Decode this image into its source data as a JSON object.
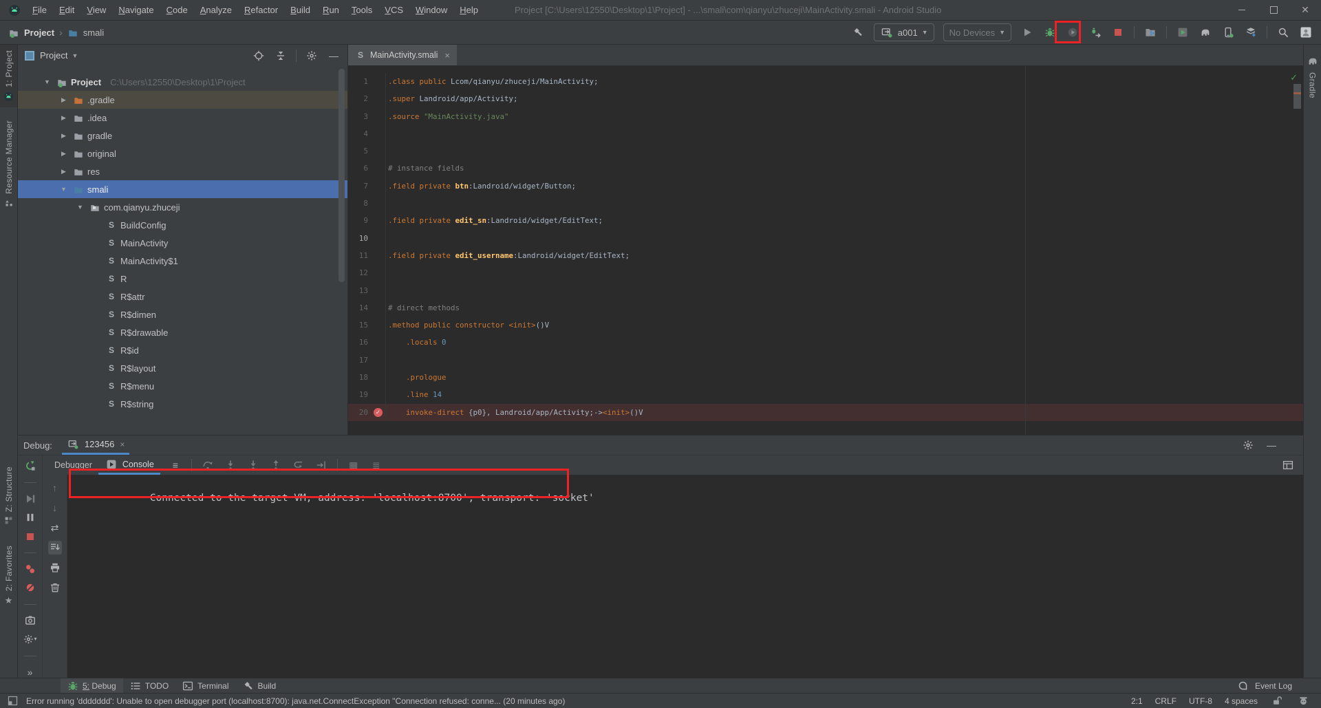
{
  "window": {
    "title": "Project [C:\\Users\\12550\\Desktop\\1\\Project] - ...\\smali\\com\\qianyu\\zhuceji\\MainActivity.smali - Android Studio",
    "menus": [
      "File",
      "Edit",
      "View",
      "Navigate",
      "Code",
      "Analyze",
      "Refactor",
      "Build",
      "Run",
      "Tools",
      "VCS",
      "Window",
      "Help"
    ],
    "controls": [
      "minimize",
      "maximize",
      "close"
    ]
  },
  "toolbar": {
    "breadcrumb_root": "Project",
    "breadcrumb_current": "smali",
    "run_config": "a001",
    "device_selector": "No Devices",
    "left_icons": [
      "build-hammer"
    ],
    "right_icons": [
      "run",
      "debug-bug",
      "profile",
      "attach-debugger",
      "stop",
      "|",
      "profile-apk",
      "|",
      "run-emulator",
      "gradle-sync",
      "avd-manager",
      "sdk-manager",
      "|",
      "search-everywhere",
      "user-avatar"
    ]
  },
  "left_stripe": {
    "project_tab": "1: Project",
    "resource_manager_tab": "Resource Manager",
    "structure_tab": "Z: Structure",
    "favorites_tab": "2: Favorites"
  },
  "project_panel": {
    "header": "Project",
    "header_icons": [
      "locate-file",
      "expand-collapse",
      "|",
      "panel-settings-gear",
      "hide-panel"
    ],
    "tree": [
      {
        "lvl": 0,
        "exp": true,
        "icon": "project-folder",
        "label": "Project",
        "path": "C:\\Users\\12550\\Desktop\\1\\Project",
        "bold": true
      },
      {
        "lvl": 1,
        "exp": false,
        "icon": "folder-gradle",
        "label": ".gradle",
        "hover": true
      },
      {
        "lvl": 1,
        "exp": false,
        "icon": "folder",
        "label": ".idea"
      },
      {
        "lvl": 1,
        "exp": false,
        "icon": "folder",
        "label": "gradle"
      },
      {
        "lvl": 1,
        "exp": false,
        "icon": "folder",
        "label": "original"
      },
      {
        "lvl": 1,
        "exp": false,
        "icon": "folder",
        "label": "res"
      },
      {
        "lvl": 1,
        "exp": true,
        "icon": "folder-blue",
        "label": "smali",
        "selected": true
      },
      {
        "lvl": 2,
        "exp": true,
        "icon": "package",
        "label": "com.qianyu.zhuceji"
      },
      {
        "lvl": 3,
        "icon": "s-file",
        "label": "BuildConfig"
      },
      {
        "lvl": 3,
        "icon": "s-file",
        "label": "MainActivity"
      },
      {
        "lvl": 3,
        "icon": "s-file",
        "label": "MainActivity$1"
      },
      {
        "lvl": 3,
        "icon": "s-file",
        "label": "R"
      },
      {
        "lvl": 3,
        "icon": "s-file",
        "label": "R$attr"
      },
      {
        "lvl": 3,
        "icon": "s-file",
        "label": "R$dimen"
      },
      {
        "lvl": 3,
        "icon": "s-file",
        "label": "R$drawable"
      },
      {
        "lvl": 3,
        "icon": "s-file",
        "label": "R$id"
      },
      {
        "lvl": 3,
        "icon": "s-file",
        "label": "R$layout"
      },
      {
        "lvl": 3,
        "icon": "s-file",
        "label": "R$menu"
      },
      {
        "lvl": 3,
        "icon": "s-file",
        "label": "R$string"
      }
    ]
  },
  "editor": {
    "tab": "MainActivity.smali",
    "close_glyph": "×",
    "token_colors": {
      "k": "#CC7832",
      "d": "#A9B7C6",
      "s": "#6A8759",
      "c": "#808080",
      "f": "#FFC66D",
      "n": "#6897BB"
    },
    "lines": [
      {
        "n": 1,
        "seg": [
          [
            "k",
            ".class "
          ],
          [
            "k",
            "public "
          ],
          [
            "d",
            "Lcom/qianyu/zhuceji/MainActivity;"
          ]
        ]
      },
      {
        "n": 2,
        "seg": [
          [
            "k",
            ".super "
          ],
          [
            "d",
            "Landroid/app/Activity;"
          ]
        ]
      },
      {
        "n": 3,
        "seg": [
          [
            "k",
            ".source "
          ],
          [
            "s",
            "\"MainActivity.java\""
          ]
        ]
      },
      {
        "n": 4,
        "seg": []
      },
      {
        "n": 5,
        "seg": []
      },
      {
        "n": 6,
        "seg": [
          [
            "c",
            "# instance fields"
          ]
        ]
      },
      {
        "n": 7,
        "seg": [
          [
            "k",
            ".field "
          ],
          [
            "k",
            "private "
          ],
          [
            "f",
            "btn"
          ],
          [
            "d",
            ":Landroid/widget/Button;"
          ]
        ]
      },
      {
        "n": 8,
        "seg": []
      },
      {
        "n": 9,
        "seg": [
          [
            "k",
            ".field "
          ],
          [
            "k",
            "private "
          ],
          [
            "f",
            "edit_sn"
          ],
          [
            "d",
            ":Landroid/widget/EditText;"
          ]
        ]
      },
      {
        "n": 10,
        "cur": true,
        "seg": []
      },
      {
        "n": 11,
        "seg": [
          [
            "k",
            ".field "
          ],
          [
            "k",
            "private "
          ],
          [
            "f",
            "edit_username"
          ],
          [
            "d",
            ":Landroid/widget/EditText;"
          ]
        ]
      },
      {
        "n": 12,
        "seg": []
      },
      {
        "n": 13,
        "seg": []
      },
      {
        "n": 14,
        "seg": [
          [
            "c",
            "# direct methods"
          ]
        ]
      },
      {
        "n": 15,
        "seg": [
          [
            "k",
            ".method "
          ],
          [
            "k",
            "public "
          ],
          [
            "k",
            "constructor "
          ],
          [
            "k",
            "<init>"
          ],
          [
            "d",
            "()V"
          ]
        ]
      },
      {
        "n": 16,
        "seg": [
          [
            "d",
            "    "
          ],
          [
            "k",
            ".locals "
          ],
          [
            "n2",
            "0"
          ]
        ]
      },
      {
        "n": 17,
        "seg": []
      },
      {
        "n": 18,
        "seg": [
          [
            "d",
            "    "
          ],
          [
            "k",
            ".prologue"
          ]
        ]
      },
      {
        "n": 19,
        "seg": [
          [
            "d",
            "    "
          ],
          [
            "k",
            ".line "
          ],
          [
            "n2",
            "14"
          ]
        ]
      },
      {
        "n": 20,
        "bp": true,
        "hl": true,
        "seg": [
          [
            "d",
            "    "
          ],
          [
            "k",
            "invoke-direct "
          ],
          [
            "d",
            "{p0}, Landroid/app/Activity;->"
          ],
          [
            "k",
            "<init>"
          ],
          [
            "d",
            "()V"
          ]
        ]
      }
    ]
  },
  "debug_panel": {
    "label": "Debug:",
    "session_tab": "123456",
    "tabs": [
      {
        "label": "Debugger",
        "active": false,
        "icon": null
      },
      {
        "label": "Console",
        "active": true,
        "icon": "console"
      }
    ],
    "header_icons": [
      "debug-gear",
      "hide-debug-panel"
    ],
    "toolbar_icons": [
      "layout-options",
      "|",
      "step-over",
      "step-into",
      "force-step-into",
      "step-out",
      "drop-frame",
      "run-to-cursor",
      "|",
      "evaluate",
      "view-options"
    ],
    "restore_layout_icon": "restore-layout",
    "col1_icons": [
      "rerun-debug",
      "-",
      "resume",
      "pause",
      "stop-debug",
      "-",
      "view-breakpoints",
      "mute-breakpoints",
      "-",
      "thread-dump-camera",
      "debug-settings-gear",
      "-",
      "more-chevrons"
    ],
    "col2_icons": [
      "up-stack",
      "down-stack",
      "soft-wrap",
      "scroll-to-end",
      "print",
      "clear-console"
    ],
    "console_text": "Connected to the target VM, address: 'localhost:8700', transport: 'socket'"
  },
  "bottom_bar": {
    "tabs": [
      {
        "icon": "debug-bug",
        "label": "5: Debug",
        "active": true
      },
      {
        "icon": "todo",
        "label": "TODO",
        "active": false
      },
      {
        "icon": "terminal",
        "label": "Terminal",
        "active": false
      },
      {
        "icon": "build-hammer",
        "label": "Build",
        "active": false
      }
    ],
    "event_log": "Event Log"
  },
  "status_bar": {
    "message": "Error running 'ddddddd': Unable to open debugger port (localhost:8700): java.net.ConnectException \"Connection refused: conne... (20 minutes ago)",
    "caret": "2:1",
    "line_separator": "CRLF",
    "encoding": "UTF-8",
    "indent": "4 spaces",
    "icons": [
      "padlock",
      "hector"
    ]
  },
  "right_stripe": {
    "gradle_tab": "Gradle"
  },
  "annotations": {
    "color": "#EC2225",
    "boxes": [
      "debug-button-highlight",
      "console-message-highlight"
    ]
  }
}
